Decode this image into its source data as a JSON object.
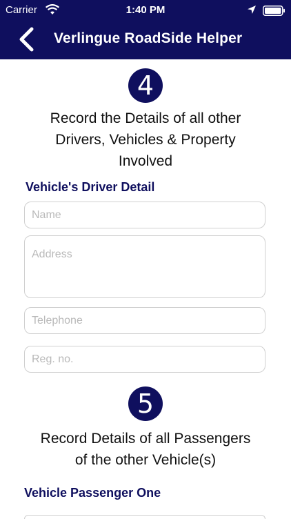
{
  "status_bar": {
    "carrier": "Carrier",
    "time": "1:40 PM"
  },
  "nav": {
    "title": "Verlingue RoadSide Helper",
    "back_icon": "chevron-left-icon"
  },
  "step4": {
    "number": "4",
    "lines": [
      "Record the Details of all other",
      "Drivers, Vehicles & Property",
      "Involved"
    ],
    "section_heading": "Vehicle's Driver Detail",
    "fields": {
      "name_placeholder": "Name",
      "address_placeholder": "Address",
      "telephone_placeholder": "Telephone",
      "reg_placeholder": "Reg. no."
    }
  },
  "step5": {
    "number": "5",
    "lines": [
      "Record Details of all Passengers",
      "of the other Vehicle(s)"
    ],
    "section_heading": "Vehicle Passenger One"
  },
  "colors": {
    "brand": "#0f0f5e",
    "field_border": "#cfcfcf",
    "placeholder": "#b9b9b9"
  }
}
